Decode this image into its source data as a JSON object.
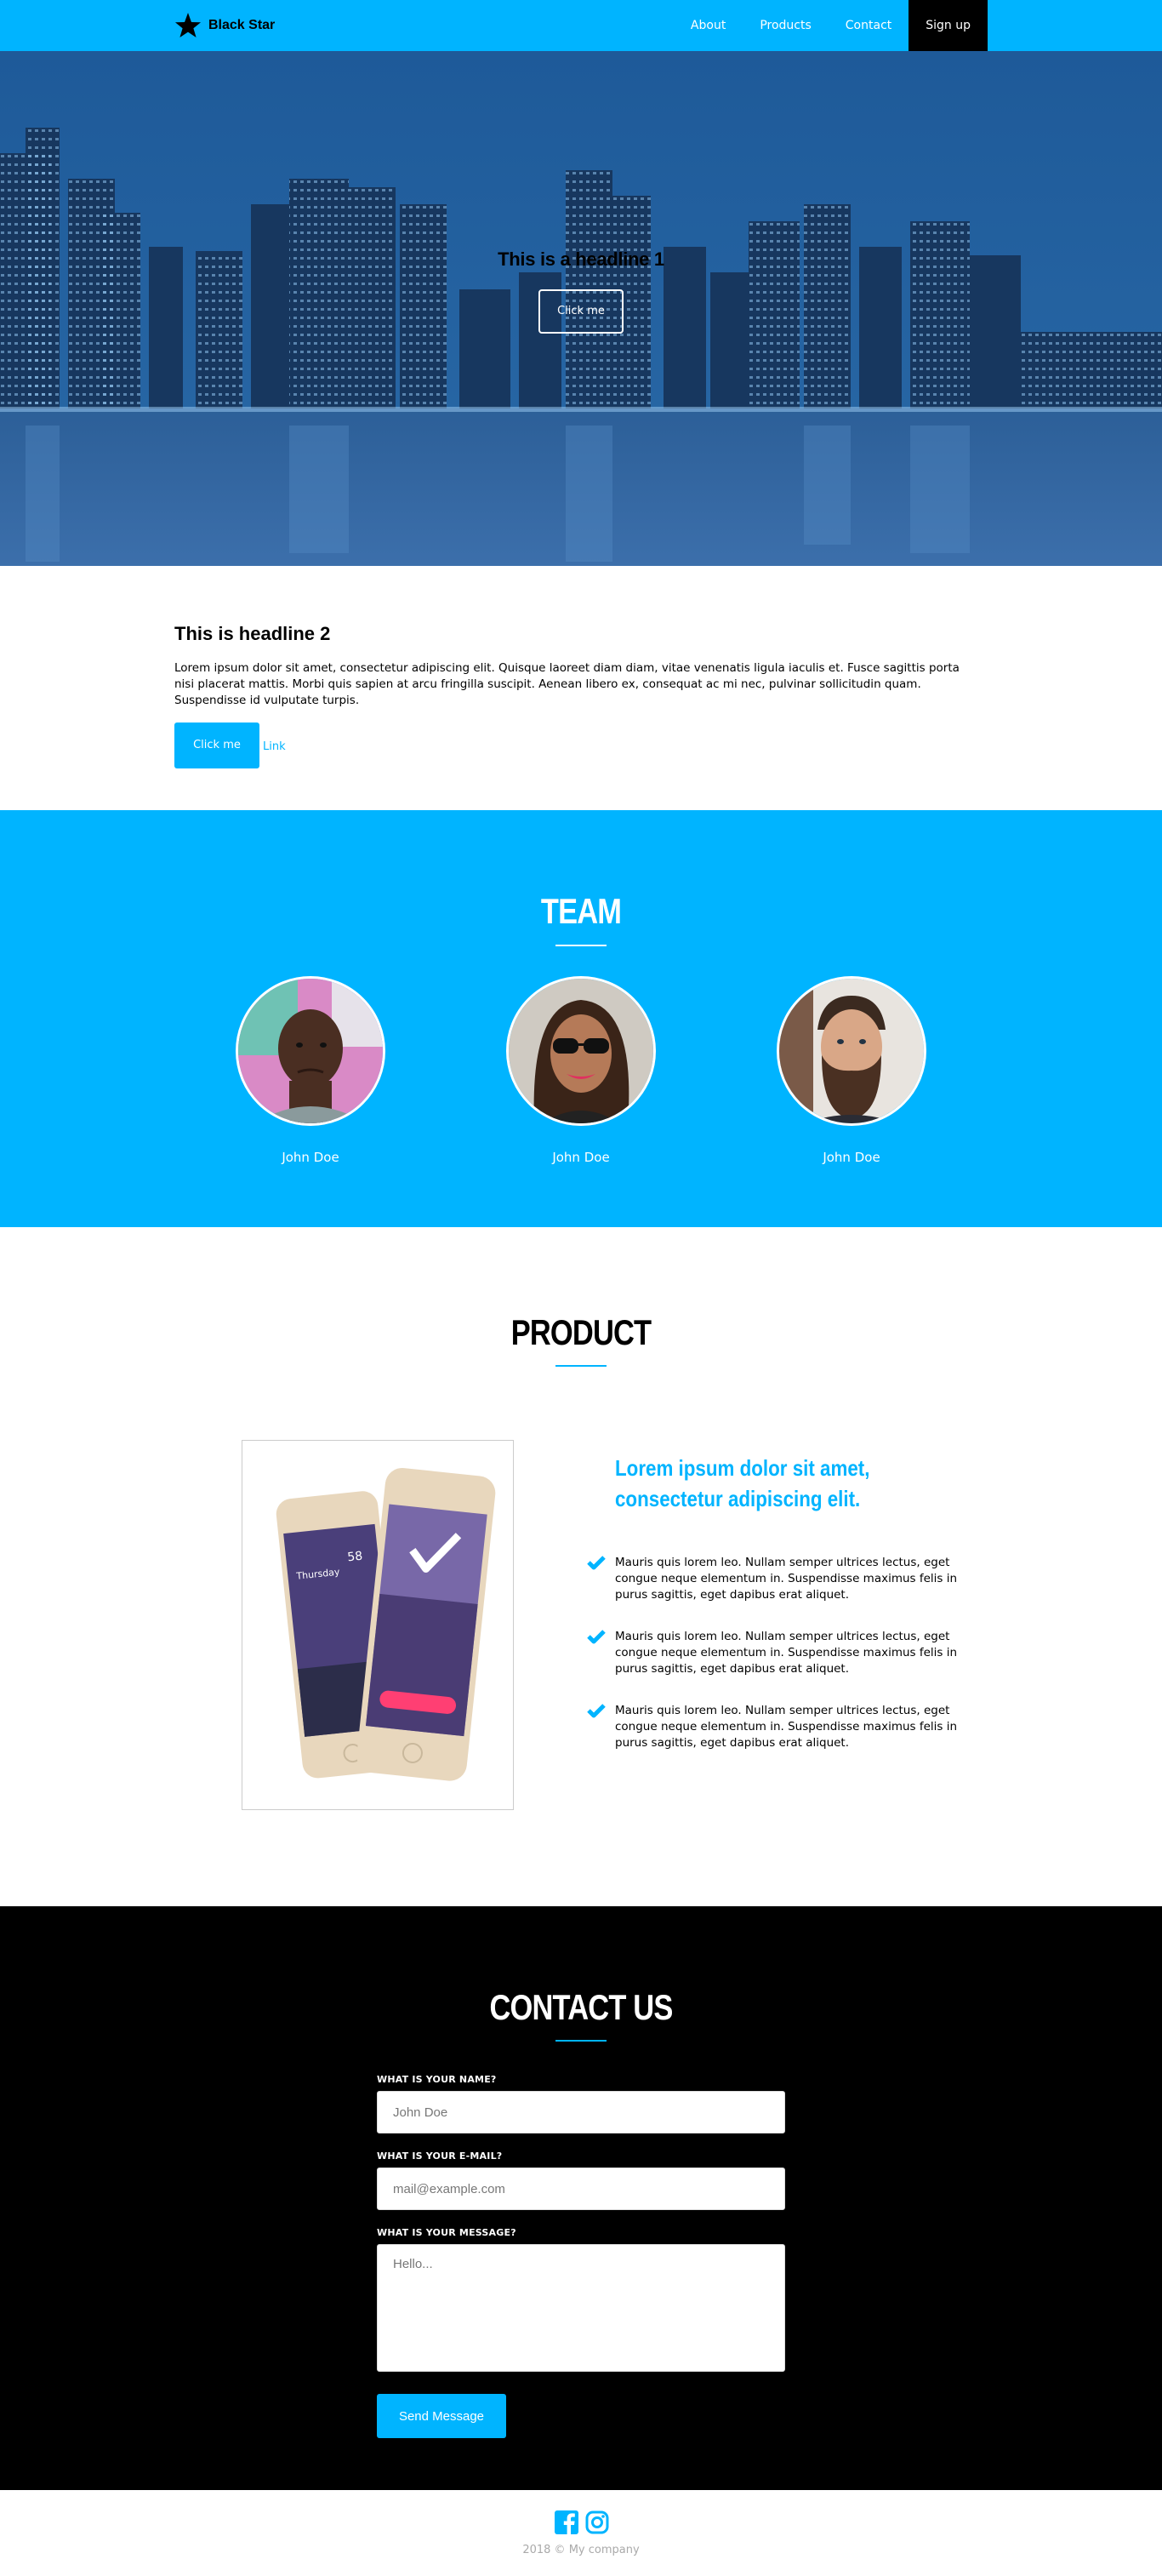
{
  "nav": {
    "brand": "Black Star",
    "links": [
      "About",
      "Products",
      "Contact"
    ],
    "signup": "Sign up"
  },
  "hero": {
    "title": "This is a headline 1",
    "button": "Click me"
  },
  "section2": {
    "title": "This is headline 2",
    "text": "Lorem ipsum dolor sit amet, consectetur adipiscing elit. Quisque laoreet diam diam, vitae venenatis ligula iaculis et. Fusce sagittis porta nisi placerat mattis. Morbi quis sapien at arcu fringilla suscipit. Aenean libero ex, consequat ac mi nec, pulvinar sollicitudin quam. Suspendisse id vulputate turpis.",
    "button": "Click me",
    "link": "Link"
  },
  "team": {
    "title": "TEAM",
    "members": [
      {
        "name": "John Doe"
      },
      {
        "name": "John Doe"
      },
      {
        "name": "John Doe"
      }
    ]
  },
  "product": {
    "title": "PRODUCT",
    "heading": "Lorem ipsum dolor sit amet, consectetur adipiscing elit.",
    "features": [
      "Mauris quis lorem leo. Nullam semper ultrices lectus, eget congue neque elementum in. Suspendisse maximus felis in purus sagittis, eget dapibus erat aliquet.",
      "Mauris quis lorem leo. Nullam semper ultrices lectus, eget congue neque elementum in. Suspendisse maximus felis in purus sagittis, eget dapibus erat aliquet.",
      "Mauris quis lorem leo. Nullam semper ultrices lectus, eget congue neque elementum in. Suspendisse maximus felis in purus sagittis, eget dapibus erat aliquet."
    ],
    "phone_screen_left": {
      "day": "Thursday",
      "temp": "58"
    }
  },
  "contact": {
    "title": "CONTACT US",
    "name_label": "WHAT IS YOUR NAME?",
    "name_placeholder": "John Doe",
    "email_label": "WHAT IS YOUR E-MAIL?",
    "email_placeholder": "mail@example.com",
    "message_label": "WHAT IS YOUR MESSAGE?",
    "message_placeholder": "Hello...",
    "send": "Send Message"
  },
  "footer": {
    "icons": [
      "facebook-icon",
      "instagram-icon"
    ],
    "copyright": "2018 © My company"
  },
  "colors": {
    "accent": "#00b4ff",
    "dark": "#000000",
    "white": "#ffffff"
  }
}
